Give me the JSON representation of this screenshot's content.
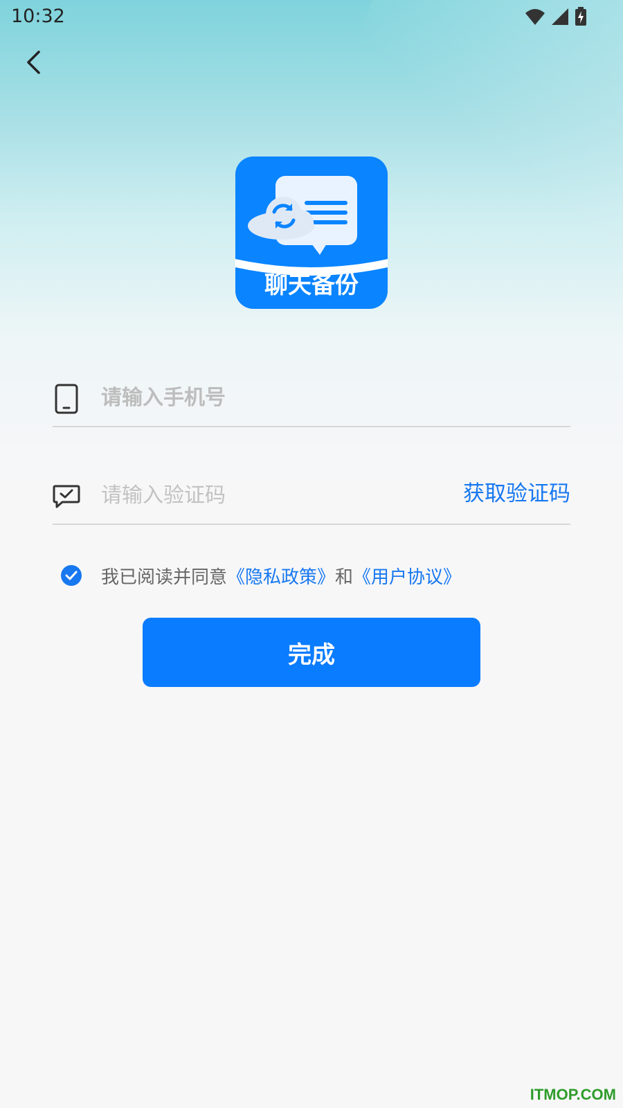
{
  "status_bar": {
    "time": "10:32",
    "icons": [
      "wifi-icon",
      "cell-signal-icon",
      "battery-charging-icon"
    ]
  },
  "nav": {
    "back_icon": "chevron-left-icon"
  },
  "logo": {
    "label": "聊天备份",
    "icons": [
      "cloud-sync-icon",
      "chat-bubble-icon"
    ]
  },
  "form": {
    "phone": {
      "icon": "phone-icon",
      "placeholder": "请输入手机号",
      "value": ""
    },
    "code": {
      "icon": "message-check-icon",
      "placeholder": "请输入验证码",
      "value": "",
      "get_code_label": "获取验证码"
    },
    "agreement": {
      "checked": true,
      "prefix": "我已阅读并同意",
      "privacy_link": "《隐私政策》",
      "conjunction": "和",
      "terms_link": "《用户协议》"
    },
    "submit_label": "完成"
  },
  "watermark": "ITMOP.COM",
  "colors": {
    "accent": "#0a7cff",
    "link": "#1778f0",
    "placeholder": "#bdbdbd",
    "watermark": "#2e9c2a"
  }
}
